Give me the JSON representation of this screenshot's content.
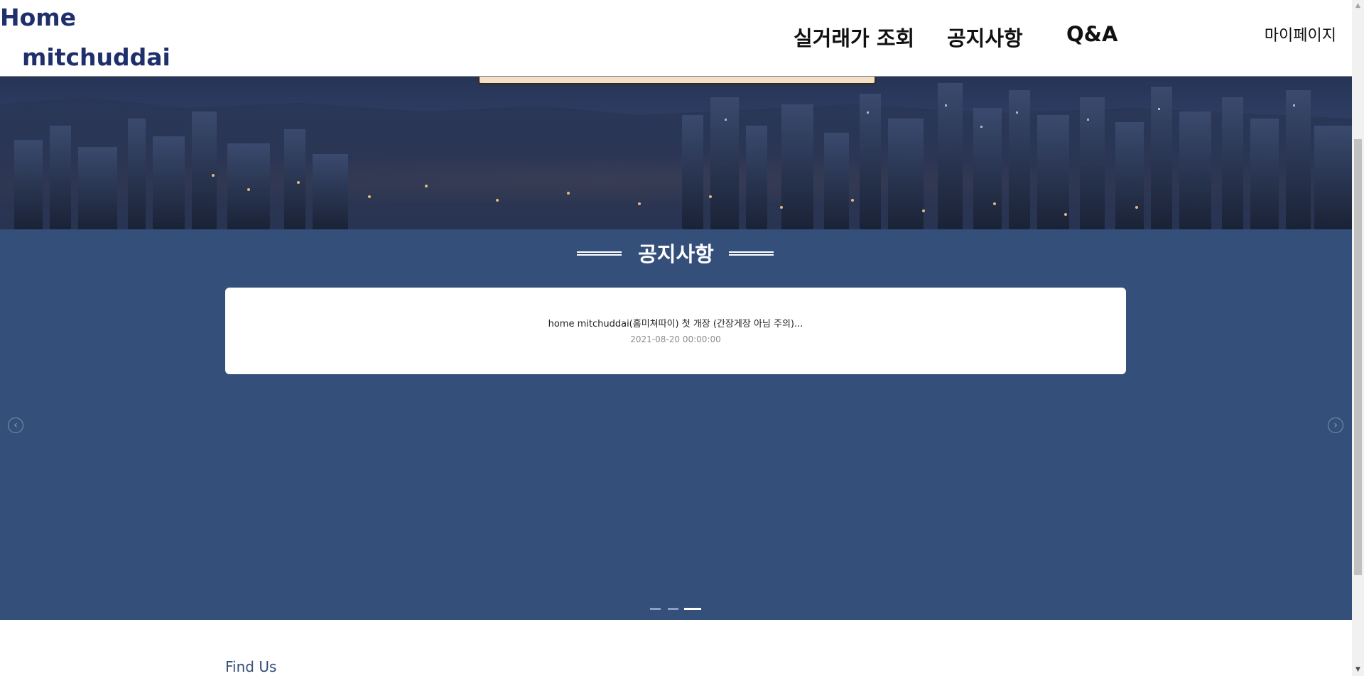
{
  "header": {
    "logo_line1": "Home",
    "logo_line2": "mitchuddai",
    "nav": {
      "price_lookup": "실거래가 조회",
      "notices": "공지사항",
      "qna": "Q&A",
      "mypage": "마이페이지"
    }
  },
  "notice": {
    "title": "공지사항",
    "items": [
      {
        "title": "home mitchuddai(홈미쳐따이) 첫 개장 (간장게장 아님 주의)...",
        "date": "2021-08-20 00:00:00"
      }
    ],
    "prev_icon": "chevron-left-circle-icon",
    "next_icon": "chevron-right-circle-icon",
    "pagination": {
      "total": 3,
      "active": 3
    }
  },
  "footer": {
    "find_us": "Find Us"
  },
  "colors": {
    "brand": "#1e2f6b",
    "notice_bg": "#354f7b",
    "card_bg": "#ffffff"
  }
}
